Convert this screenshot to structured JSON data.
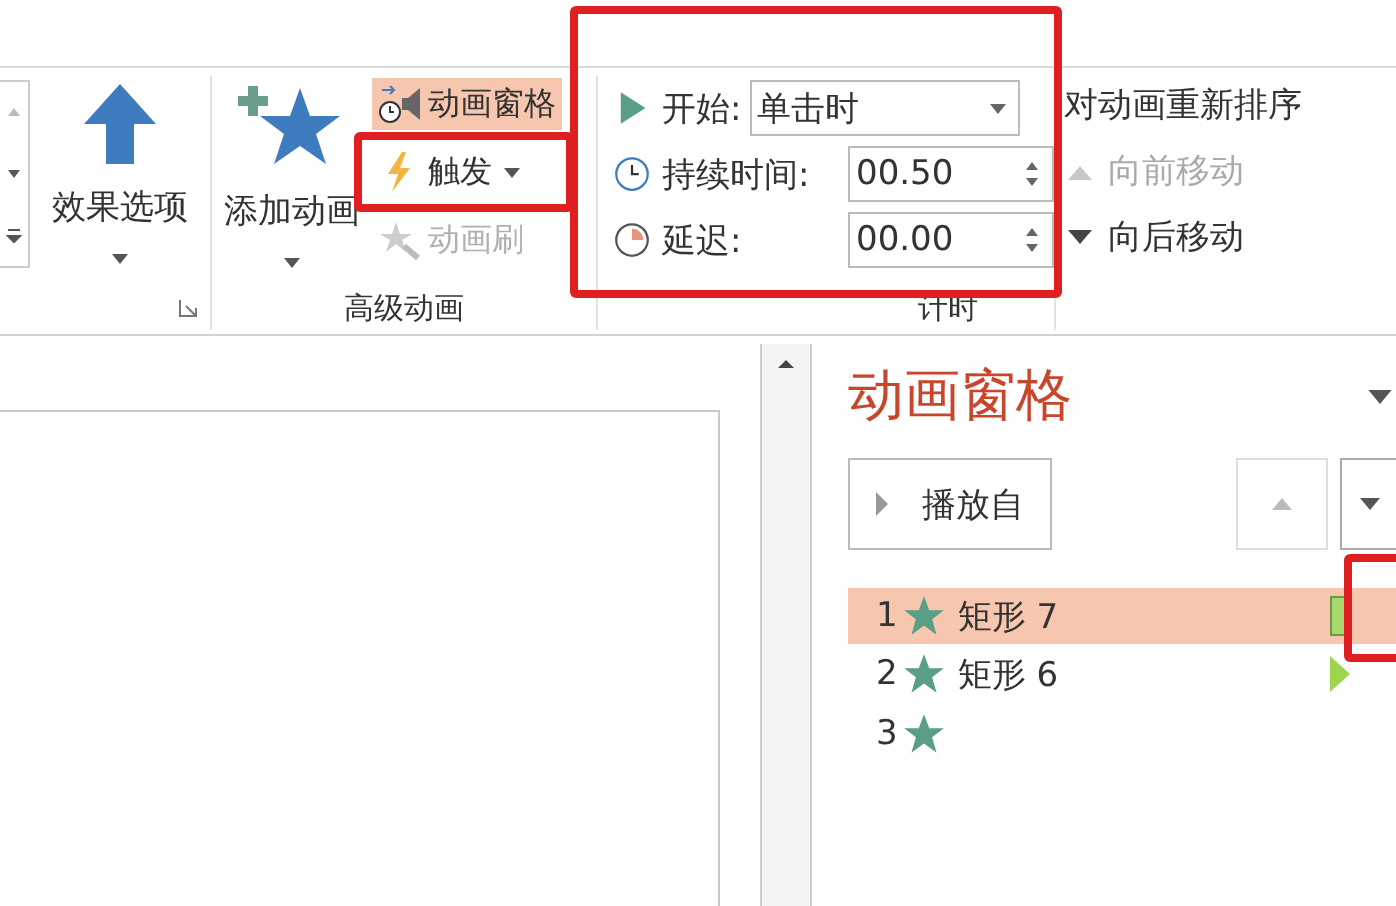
{
  "ribbon": {
    "effect_options": {
      "label": "效果选项"
    },
    "advanced_animation": {
      "label": "高级动画",
      "add_animation": {
        "label": "添加动画"
      },
      "small_buttons": [
        {
          "kind": "pane",
          "label": "动画窗格",
          "selected": true,
          "disabled": false,
          "highlighted": false,
          "dropdown": false
        },
        {
          "kind": "trigger",
          "label": "触发",
          "selected": false,
          "disabled": false,
          "highlighted": true,
          "dropdown": true
        },
        {
          "kind": "painter",
          "label": "动画刷",
          "selected": false,
          "disabled": true,
          "highlighted": false,
          "dropdown": false
        }
      ]
    },
    "timing": {
      "label": "计时",
      "highlighted": true,
      "start": {
        "label": "开始:",
        "value": "单击时"
      },
      "duration": {
        "label": "持续时间:",
        "value": "00.50"
      },
      "delay": {
        "label": "延迟:",
        "value": "00.00"
      }
    },
    "reorder": {
      "label": "对动画重新排序",
      "buttons": [
        {
          "kind": "up",
          "label": "向前移动",
          "disabled": true
        },
        {
          "kind": "down",
          "label": "向后移动",
          "disabled": false
        }
      ]
    }
  },
  "animation_pane": {
    "title": "动画窗格",
    "play_from": "播放自",
    "up_button": {
      "disabled": true
    },
    "down_button": {
      "disabled": false
    },
    "items": [
      {
        "number": "1",
        "name": "矩形 7",
        "selected": true,
        "highlighted": true,
        "kind": "bar"
      },
      {
        "number": "2",
        "name": "矩形 6",
        "selected": false,
        "highlighted": false,
        "kind": "triangle"
      },
      {
        "number": "3",
        "selected": false,
        "highlighted": false
      }
    ]
  }
}
